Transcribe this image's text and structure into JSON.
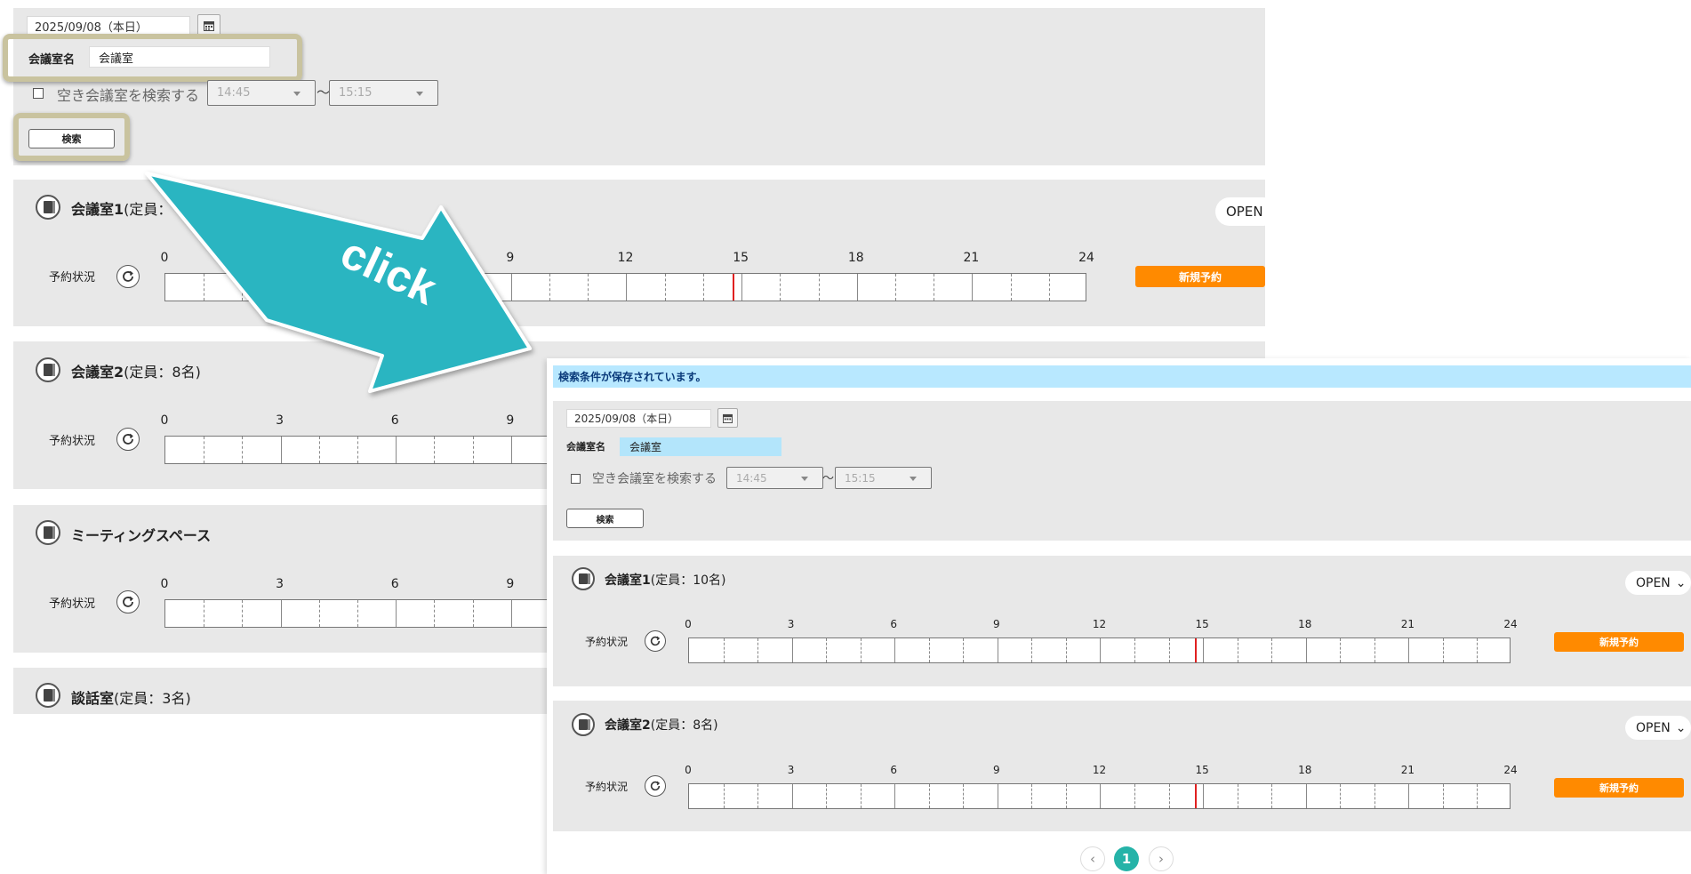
{
  "search_form": {
    "date": "2025/09/08（本日）",
    "room_name_label": "会議室名",
    "room_name_value": "会議室",
    "vacant_label": "空き会議室を検索する",
    "start_time": "14:45",
    "tilde": "〜",
    "end_time": "15:15",
    "search_label": "検索"
  },
  "rooms": [
    {
      "name": "会議室1",
      "capacity": "(定員：",
      "status_label": "予約状況",
      "open_label": "OPEN",
      "new_label": "新規予約"
    },
    {
      "name": "会議室2",
      "capacity": "(定員：8名)",
      "status_label": "予約状況"
    },
    {
      "name": "ミーティングスペース",
      "capacity": "",
      "status_label": "予約状況"
    },
    {
      "name": "談話室",
      "capacity": "(定員：3名)"
    }
  ],
  "ticks_full": [
    "0",
    "3",
    "6",
    "9",
    "12",
    "15",
    "18",
    "21",
    "24"
  ],
  "ticks_room1_visible": [
    "0",
    "9",
    "12",
    "15",
    "18",
    "21",
    "24"
  ],
  "ticks_partial": [
    "0",
    "3",
    "6",
    "9"
  ],
  "callout_text": "click",
  "result": {
    "banner": "検索条件が保存されています。",
    "form": {
      "date": "2025/09/08（本日）",
      "room_name_label": "会議室名",
      "room_name_value": "会議室",
      "vacant_label": "空き会議室を検索する",
      "start_time": "14:45",
      "tilde": "〜",
      "end_time": "15:15",
      "search_label": "検索"
    },
    "rooms": [
      {
        "name": "会議室1",
        "capacity": "(定員：10名)",
        "status_label": "予約状況",
        "open_label": "OPEN",
        "new_label": "新規予約"
      },
      {
        "name": "会議室2",
        "capacity": "(定員：8名)",
        "status_label": "予約状況",
        "open_label": "OPEN",
        "new_label": "新規予約"
      }
    ]
  },
  "pagination": {
    "prev": "‹",
    "current": "1",
    "next": "›"
  },
  "current_time_fraction": 0.615
}
